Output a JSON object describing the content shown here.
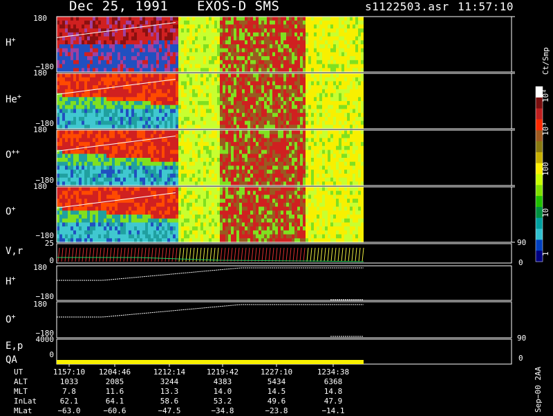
{
  "header": {
    "date": "Dec 25, 1991",
    "instrument": "EXOS-D SMS",
    "file": "s1122503.asr",
    "time": "11:57:10"
  },
  "panels": {
    "spec": [
      {
        "label": "H+",
        "top": "180",
        "bottom": "−180"
      },
      {
        "label": "He+",
        "top": "180",
        "bottom": "−180"
      },
      {
        "label": "O++",
        "top": "180",
        "bottom": "−180"
      },
      {
        "label": "O+",
        "top": "180",
        "bottom": "−180"
      }
    ],
    "vr": {
      "label": "V,r",
      "top": "25",
      "bottom": "0",
      "right_top": "90",
      "right_bottom": "0"
    },
    "h_line": {
      "label": "H+",
      "top": "180",
      "bottom": "−180"
    },
    "o_line": {
      "label": "O+",
      "top": "180",
      "bottom": "−180"
    },
    "ep": {
      "label": "E,p",
      "top": "4000",
      "right_top": "90"
    },
    "qa": {
      "label": "QA",
      "bottom": "0",
      "right_bottom": "0"
    }
  },
  "colorbar": {
    "unit": "Ct/Smp",
    "ticks": [
      "10⁴",
      "10³",
      "100",
      "10",
      "1"
    ],
    "colors": [
      "#ffffff",
      "#7a1010",
      "#c02020",
      "#ff2a00",
      "#a05a20",
      "#8a7a10",
      "#c8b000",
      "#fff000",
      "#c8ff00",
      "#80e000",
      "#20c000",
      "#009040",
      "#00a0a0",
      "#30c0d0",
      "#0040c0",
      "#000080"
    ]
  },
  "footer": {
    "rows": [
      {
        "name": "UT",
        "values": [
          "1157:10",
          "1204:46",
          "1212:14",
          "1219:42",
          "1227:10",
          "1234:38"
        ]
      },
      {
        "name": "ALT",
        "values": [
          "1033",
          "2085",
          "3244",
          "4383",
          "5434",
          "6368"
        ]
      },
      {
        "name": "MLT",
        "values": [
          "7.8",
          "11.6",
          "13.3",
          "14.0",
          "14.5",
          "14.8"
        ]
      },
      {
        "name": "InLat",
        "values": [
          "62.1",
          "64.1",
          "58.6",
          "53.2",
          "49.6",
          "47.9"
        ]
      },
      {
        "name": "MLat",
        "values": [
          "−63.0",
          "−60.6",
          "−47.5",
          "−34.8",
          "−23.8",
          "−14.1"
        ]
      }
    ],
    "version": "Sep−00 2AA"
  },
  "chart_data": {
    "type": "heatmap",
    "title": "Dec 25, 1991   EXOS-D SMS",
    "panels": [
      "H+",
      "He+",
      "O++",
      "O+",
      "V,r",
      "H+",
      "O+",
      "E,p",
      "QA"
    ],
    "ylim": [
      -180,
      180
    ],
    "x_ticks": [
      "1157:10",
      "1204:46",
      "1212:14",
      "1219:42",
      "1227:10",
      "1234:38"
    ],
    "colorbar_unit": "Ct/Smp",
    "colorbar_ticks": [
      "1",
      "10",
      "100",
      "10³",
      "10⁴"
    ]
  }
}
